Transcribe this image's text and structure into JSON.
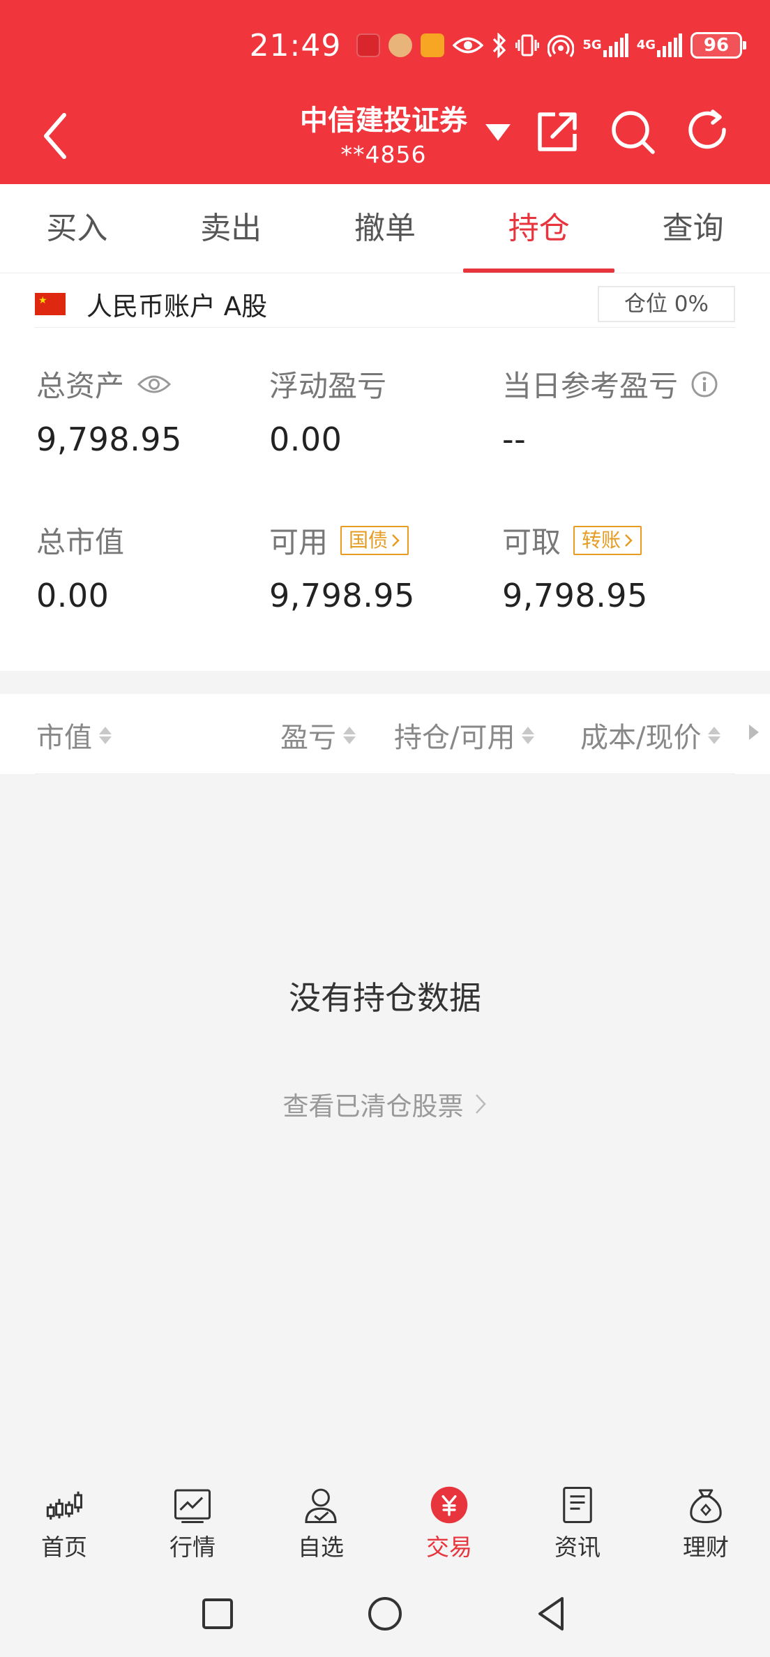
{
  "status_bar": {
    "time": "21:49",
    "network_5g": "5G",
    "network_4g": "4G",
    "battery": "96"
  },
  "header": {
    "broker_name": "中信建投证券",
    "account_masked": "**4856"
  },
  "tabs": [
    {
      "label": "买入",
      "active": false
    },
    {
      "label": "卖出",
      "active": false
    },
    {
      "label": "撤单",
      "active": false
    },
    {
      "label": "持仓",
      "active": true
    },
    {
      "label": "查询",
      "active": false
    }
  ],
  "account": {
    "label": "人民币账户 A股",
    "position_label": "仓位 0%"
  },
  "metrics": {
    "total_assets_label": "总资产",
    "total_assets_value": "9,798.95",
    "floating_pl_label": "浮动盈亏",
    "floating_pl_value": "0.00",
    "daily_pl_label": "当日参考盈亏",
    "daily_pl_value": "--",
    "market_value_label": "总市值",
    "market_value_value": "0.00",
    "available_label": "可用",
    "available_tag": "国债",
    "available_value": "9,798.95",
    "withdrawable_label": "可取",
    "withdrawable_tag": "转账",
    "withdrawable_value": "9,798.95"
  },
  "list_columns": [
    "市值",
    "盈亏",
    "持仓/可用",
    "成本/现价"
  ],
  "empty_state": {
    "title": "没有持仓数据",
    "link": "查看已清仓股票"
  },
  "bottom_nav": [
    {
      "label": "首页",
      "icon": "candlestick-icon",
      "active": false
    },
    {
      "label": "行情",
      "icon": "market-chart-icon",
      "active": false
    },
    {
      "label": "自选",
      "icon": "watchlist-user-icon",
      "active": false
    },
    {
      "label": "交易",
      "icon": "yen-coin-icon",
      "active": true
    },
    {
      "label": "资讯",
      "icon": "news-doc-icon",
      "active": false
    },
    {
      "label": "理财",
      "icon": "money-bag-icon",
      "active": false
    }
  ],
  "colors": {
    "brand_red": "#f0353d",
    "accent_red": "#e8343c",
    "tag_orange": "#e69b21"
  }
}
